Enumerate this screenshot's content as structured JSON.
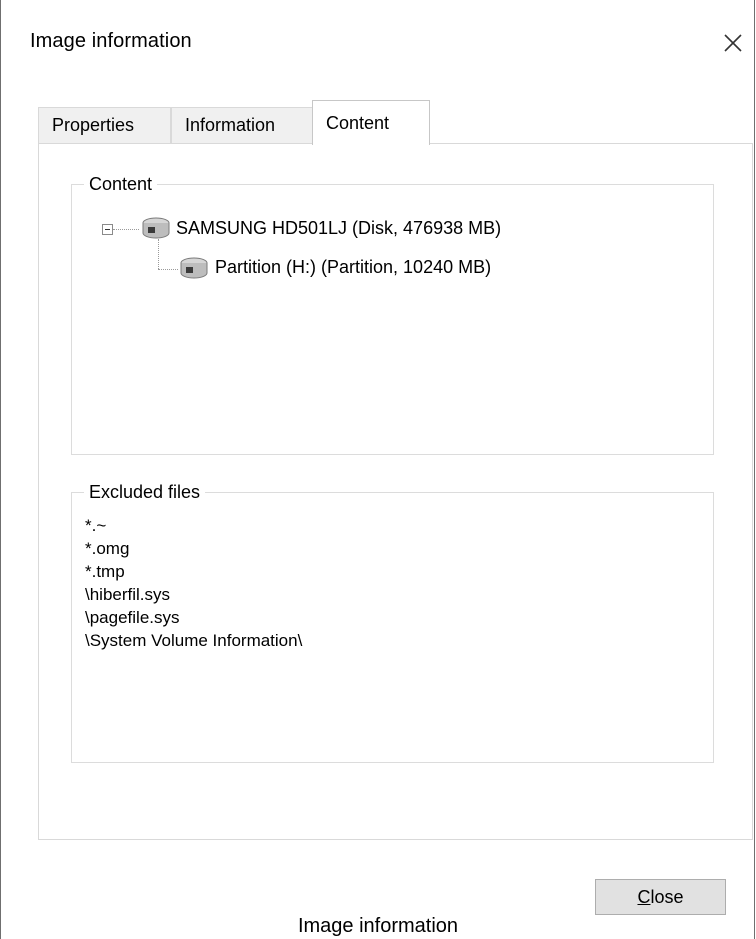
{
  "dialog": {
    "title": "Image information",
    "tabs": [
      {
        "label": "Properties"
      },
      {
        "label": "Information"
      },
      {
        "label": "Content"
      }
    ],
    "active_tab": "Content",
    "content_group": {
      "label": "Content",
      "tree": [
        {
          "label": "SAMSUNG HD501LJ (Disk, 476938 MB)",
          "icon": "disk-drive-icon",
          "expanded": true
        },
        {
          "label": "Partition (H:) (Partition, 10240 MB)",
          "icon": "partition-drive-icon"
        }
      ]
    },
    "excluded_group": {
      "label": "Excluded files",
      "items": [
        "*.~",
        "*.omg",
        "*.tmp",
        "\\hiberfil.sys",
        "\\pagefile.sys",
        "\\System Volume Information\\"
      ]
    },
    "close_button": {
      "prefix": "C",
      "rest": "lose"
    }
  },
  "caption": "Image information"
}
